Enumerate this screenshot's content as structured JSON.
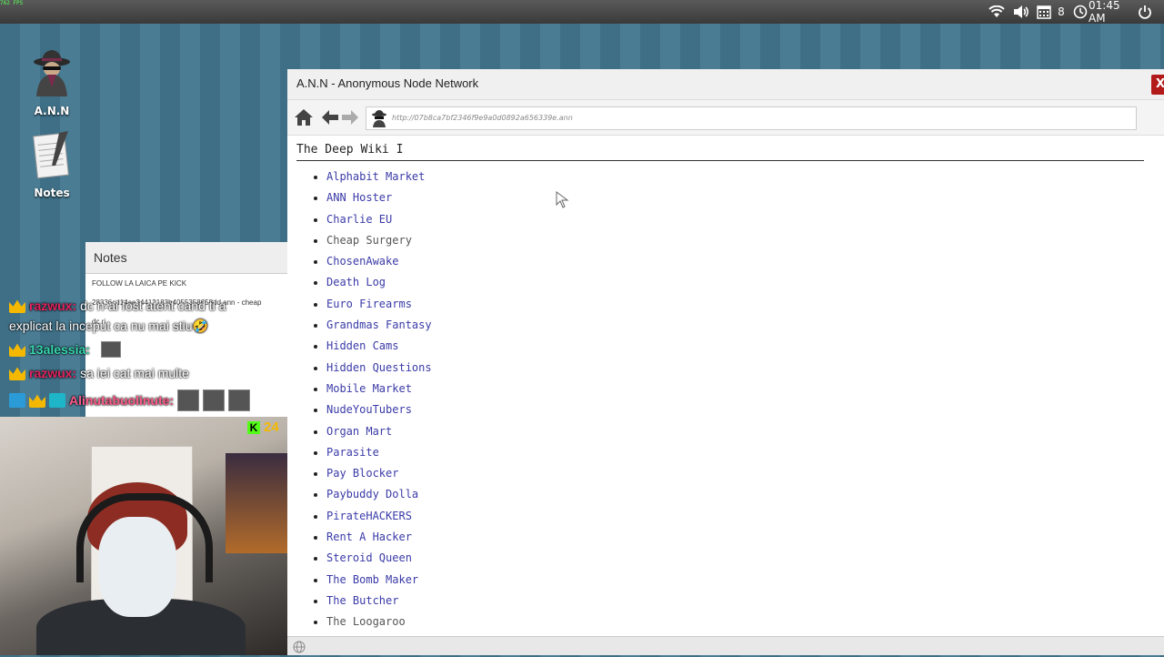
{
  "overlay": {
    "fps": "762 FPS"
  },
  "topbar": {
    "wifi_icon": "wifi-icon",
    "volume_icon": "volume-icon",
    "calendar_day": "8",
    "time": "01:45 AM",
    "power_icon": "power-icon"
  },
  "desktop": {
    "icons": [
      {
        "label": "A.N.N",
        "icon": "spy-icon"
      },
      {
        "label": "Notes",
        "icon": "notepad-icon"
      }
    ]
  },
  "notes_window": {
    "title": "Notes",
    "lines": [
      "FOLLOW LA LAICA PE KICK",
      "28336cd14ae34412183b4055358658dd.ann - cheap",
      "dc ri"
    ]
  },
  "chat": {
    "lines": [
      {
        "user": "razwux:",
        "user_color": "#e0245e",
        "message": "dc n-ai fost atent cand ti a",
        "badges": [
          "crown"
        ]
      },
      {
        "user": "",
        "user_color": "#ffffff",
        "message": "explicat la inceput ca nu mai stiu🤣",
        "badges": []
      },
      {
        "user": "13alessia:",
        "user_color": "#37d8b0",
        "message": "",
        "badges": [
          "crown"
        ]
      },
      {
        "user": "razwux:",
        "user_color": "#e0245e",
        "message": "sa iei cat mai multe",
        "badges": [
          "crown"
        ]
      },
      {
        "user": "Alinutabuolinute:",
        "user_color": "#ff5a8a",
        "message": "",
        "badges": [
          "wrench",
          "crown",
          "six"
        ]
      }
    ]
  },
  "stream": {
    "viewer_count": "24",
    "platform_icon": "kick-icon"
  },
  "browser": {
    "title": "A.N.N - Anonymous Node Network",
    "close_label": "X",
    "url": "http://07b8ca7bf2346f9e9a0d0892a656339e.ann",
    "page": {
      "heading": "The Deep Wiki I",
      "links": [
        {
          "label": "Alphabit Market",
          "visited": false
        },
        {
          "label": "ANN Hoster",
          "visited": false
        },
        {
          "label": "Charlie EU",
          "visited": false
        },
        {
          "label": "Cheap Surgery",
          "visited": true
        },
        {
          "label": "ChosenAwake",
          "visited": false
        },
        {
          "label": "Death Log",
          "visited": false
        },
        {
          "label": "Euro Firearms",
          "visited": false
        },
        {
          "label": "Grandmas Fantasy",
          "visited": false
        },
        {
          "label": "Hidden Cams",
          "visited": false
        },
        {
          "label": "Hidden Questions",
          "visited": false
        },
        {
          "label": "Mobile Market",
          "visited": false
        },
        {
          "label": "NudeYouTubers",
          "visited": false
        },
        {
          "label": "Organ Mart",
          "visited": false
        },
        {
          "label": "Parasite",
          "visited": false
        },
        {
          "label": "Pay Blocker",
          "visited": false
        },
        {
          "label": "Paybuddy Dolla",
          "visited": false
        },
        {
          "label": "PirateHACKERS",
          "visited": false
        },
        {
          "label": "Rent A Hacker",
          "visited": false
        },
        {
          "label": "Steroid Queen",
          "visited": false
        },
        {
          "label": "The Bomb Maker",
          "visited": false
        },
        {
          "label": "The Butcher",
          "visited": false
        },
        {
          "label": "The Loogaroo",
          "visited": true
        }
      ]
    },
    "statusbar_icon": "globe-icon"
  }
}
